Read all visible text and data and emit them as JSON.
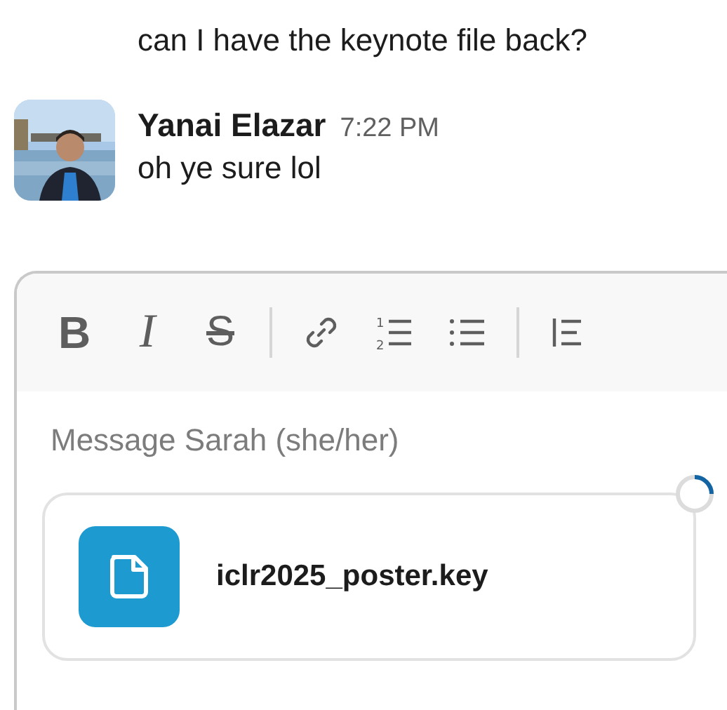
{
  "messages": [
    {
      "text": "can I have the keynote file back?"
    },
    {
      "author": "Yanai Elazar",
      "time": "7:22 PM",
      "text": "oh ye sure lol"
    }
  ],
  "composer": {
    "toolbar": [
      {
        "kind": "bold",
        "glyph": "B"
      },
      {
        "kind": "italic",
        "glyph": "I"
      },
      {
        "kind": "strike",
        "glyph": "S"
      },
      {
        "kind": "divider"
      },
      {
        "kind": "link"
      },
      {
        "kind": "ordered-list",
        "digits": [
          "1",
          "2"
        ]
      },
      {
        "kind": "bullet-list"
      },
      {
        "kind": "divider"
      },
      {
        "kind": "blockquote"
      }
    ],
    "placeholder": "Message Sarah (she/her)",
    "attachment": {
      "filename": "iclr2025_poster.key",
      "uploading": true
    }
  }
}
